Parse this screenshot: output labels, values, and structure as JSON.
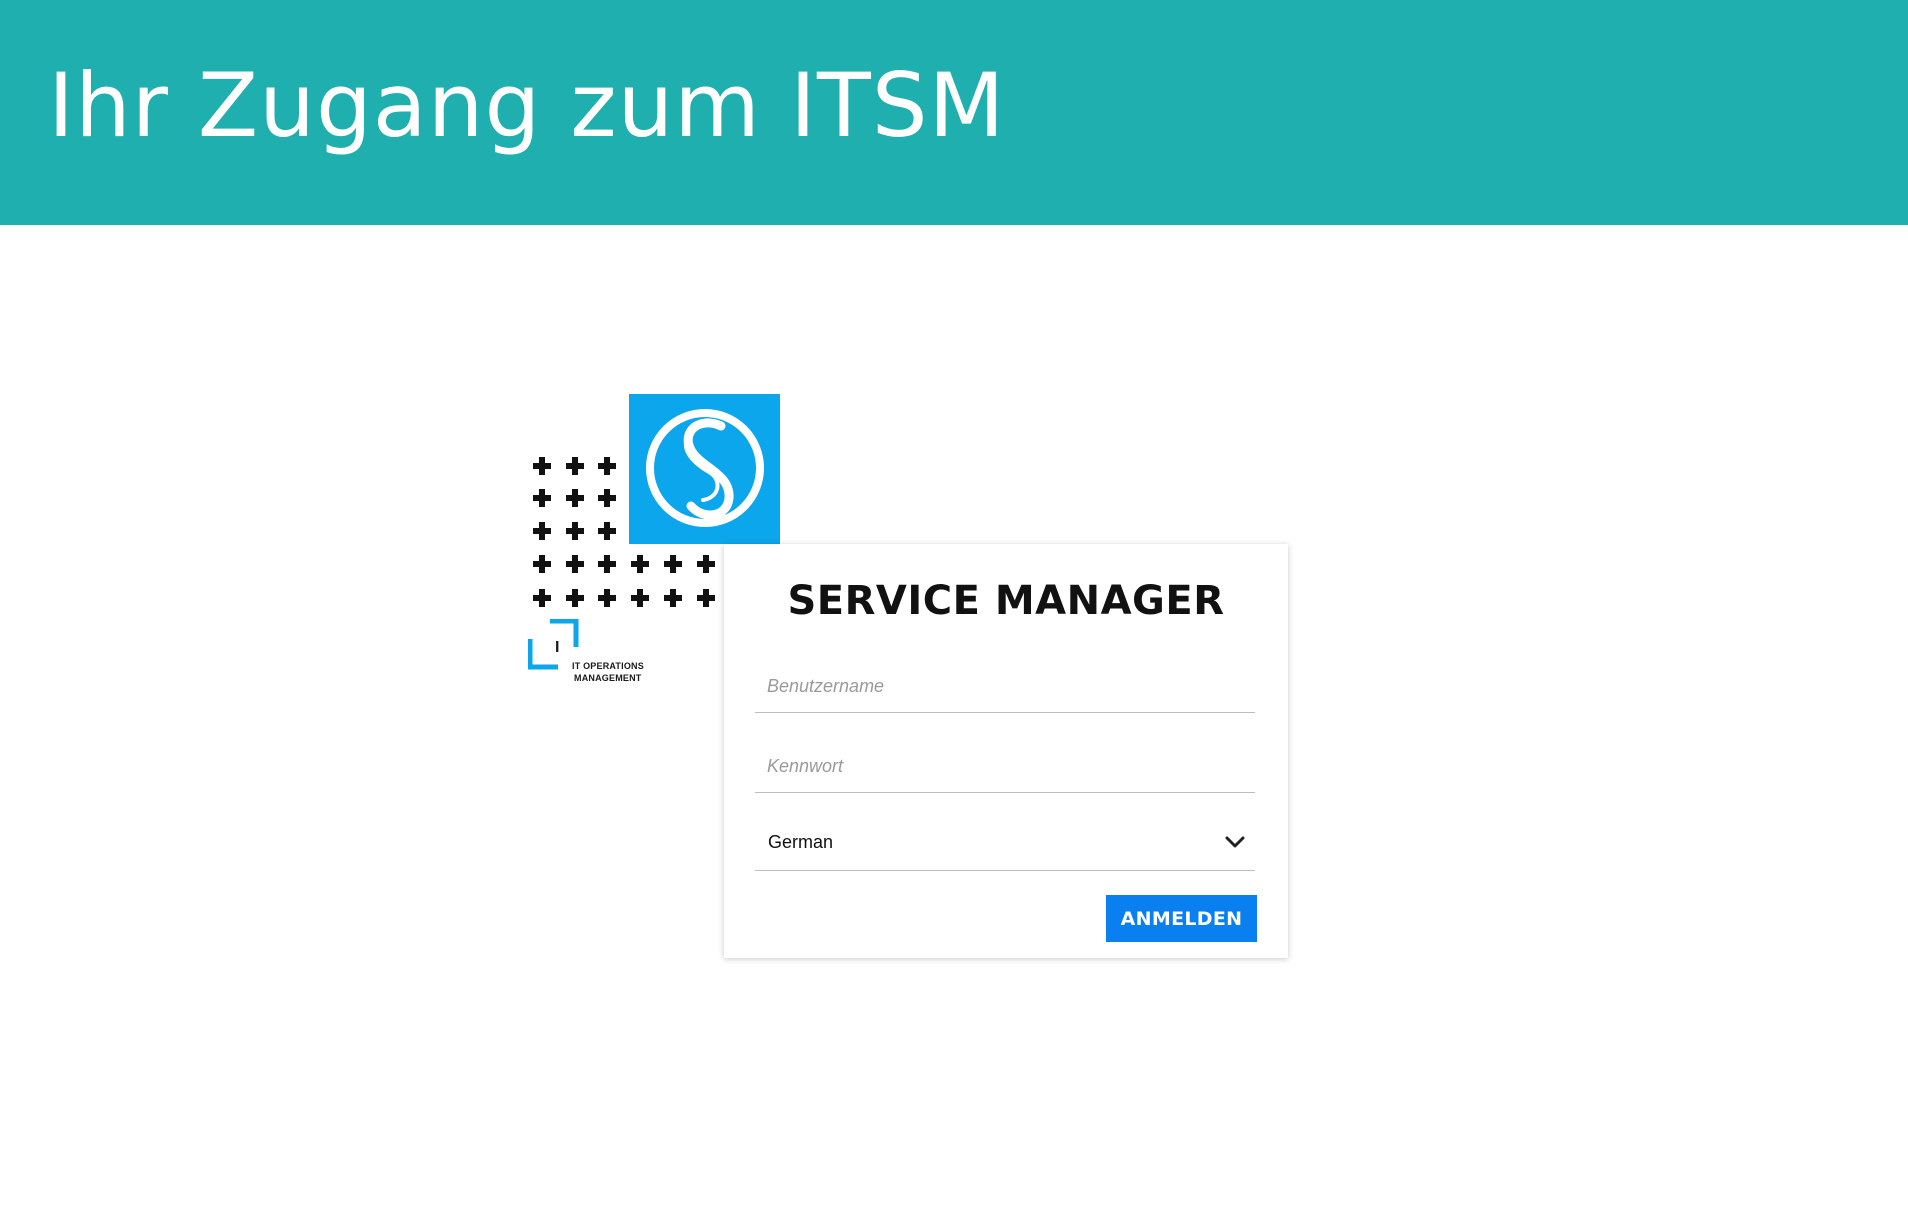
{
  "banner": {
    "title": "Ihr Zugang zum ITSM",
    "background_color": "#1fafae"
  },
  "branding": {
    "logo_icon": "s-swirl-icon",
    "logo_color": "#0ca6ec",
    "itom_mark_letter": "I",
    "itom_line1": "IT OPERATIONS",
    "itom_line2": "MANAGEMENT"
  },
  "login": {
    "title": "SERVICE MANAGER",
    "username_placeholder": "Benutzername",
    "password_placeholder": "Kennwort",
    "language_value": "German",
    "submit_label": "ANMELDEN",
    "button_color": "#0a7ff0"
  }
}
